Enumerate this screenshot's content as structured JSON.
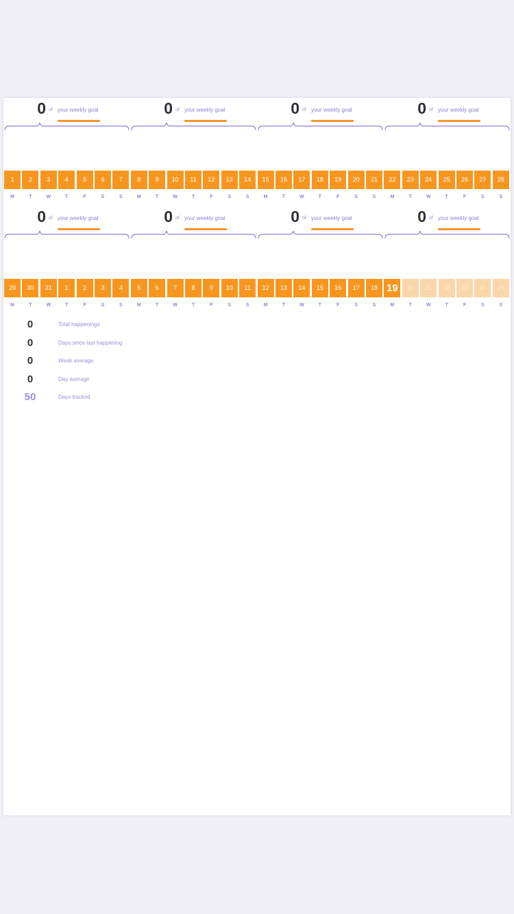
{
  "colors": {
    "accent": "#f7961f",
    "future": "#fbd6a8",
    "label": "#8f86d0",
    "brace": "#8a80d8"
  },
  "goal_of": "of",
  "goal_text": "your weekly goal",
  "months": [
    {
      "weeks": [
        {
          "count": "0"
        },
        {
          "count": "0"
        },
        {
          "count": "0"
        },
        {
          "count": "0"
        }
      ],
      "days": [
        {
          "n": "1",
          "state": "past"
        },
        {
          "n": "2",
          "state": "past"
        },
        {
          "n": "3",
          "state": "past"
        },
        {
          "n": "4",
          "state": "past"
        },
        {
          "n": "5",
          "state": "past"
        },
        {
          "n": "6",
          "state": "past"
        },
        {
          "n": "7",
          "state": "past"
        },
        {
          "n": "8",
          "state": "past"
        },
        {
          "n": "9",
          "state": "past"
        },
        {
          "n": "10",
          "state": "past"
        },
        {
          "n": "11",
          "state": "past"
        },
        {
          "n": "12",
          "state": "past"
        },
        {
          "n": "13",
          "state": "past"
        },
        {
          "n": "14",
          "state": "past"
        },
        {
          "n": "15",
          "state": "past"
        },
        {
          "n": "16",
          "state": "past"
        },
        {
          "n": "17",
          "state": "past"
        },
        {
          "n": "18",
          "state": "past"
        },
        {
          "n": "19",
          "state": "past"
        },
        {
          "n": "20",
          "state": "past"
        },
        {
          "n": "21",
          "state": "past"
        },
        {
          "n": "22",
          "state": "past"
        },
        {
          "n": "23",
          "state": "past"
        },
        {
          "n": "24",
          "state": "past"
        },
        {
          "n": "25",
          "state": "past"
        },
        {
          "n": "26",
          "state": "past"
        },
        {
          "n": "27",
          "state": "past"
        },
        {
          "n": "28",
          "state": "past"
        }
      ]
    },
    {
      "weeks": [
        {
          "count": "0"
        },
        {
          "count": "0"
        },
        {
          "count": "0"
        },
        {
          "count": "0"
        }
      ],
      "days": [
        {
          "n": "29",
          "state": "past"
        },
        {
          "n": "30",
          "state": "past"
        },
        {
          "n": "31",
          "state": "past"
        },
        {
          "n": "1",
          "state": "past"
        },
        {
          "n": "2",
          "state": "past"
        },
        {
          "n": "3",
          "state": "past"
        },
        {
          "n": "4",
          "state": "past"
        },
        {
          "n": "5",
          "state": "past"
        },
        {
          "n": "6",
          "state": "past"
        },
        {
          "n": "7",
          "state": "past"
        },
        {
          "n": "8",
          "state": "past"
        },
        {
          "n": "9",
          "state": "past"
        },
        {
          "n": "10",
          "state": "past"
        },
        {
          "n": "11",
          "state": "past"
        },
        {
          "n": "12",
          "state": "past"
        },
        {
          "n": "13",
          "state": "past"
        },
        {
          "n": "14",
          "state": "past"
        },
        {
          "n": "15",
          "state": "past"
        },
        {
          "n": "16",
          "state": "past"
        },
        {
          "n": "17",
          "state": "past"
        },
        {
          "n": "18",
          "state": "past"
        },
        {
          "n": "19",
          "state": "today"
        },
        {
          "n": "20",
          "state": "future"
        },
        {
          "n": "21",
          "state": "future"
        },
        {
          "n": "22",
          "state": "future"
        },
        {
          "n": "23",
          "state": "future"
        },
        {
          "n": "24",
          "state": "future"
        },
        {
          "n": "25",
          "state": "future"
        }
      ]
    }
  ],
  "weekdays": [
    "M",
    "T",
    "W",
    "T",
    "F",
    "S",
    "S"
  ],
  "stats": [
    {
      "value": "0",
      "label": "Total happenings",
      "accent": false
    },
    {
      "value": "0",
      "label": "Days since last happening",
      "accent": false
    },
    {
      "value": "0",
      "label": "Week average",
      "accent": false
    },
    {
      "value": "0",
      "label": "Day average",
      "accent": false
    },
    {
      "value": "50",
      "label": "Days tracked",
      "accent": true
    }
  ]
}
